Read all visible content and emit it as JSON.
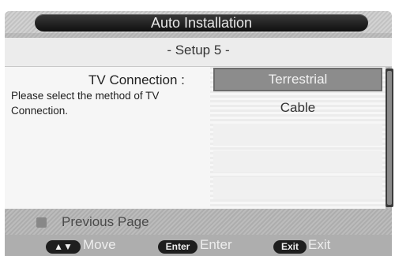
{
  "header": {
    "title": "Auto Installation"
  },
  "setup": {
    "subtitle": "- Setup 5 -"
  },
  "connection": {
    "label": "TV Connection :",
    "description": "Please select the method of TV Connection.",
    "options": [
      {
        "label": "Terrestrial",
        "selected": true
      },
      {
        "label": "Cable",
        "selected": false
      }
    ]
  },
  "footer": {
    "previous_page": "Previous Page",
    "keys": [
      {
        "key": "▲▼",
        "label": "Move"
      },
      {
        "key": "Enter",
        "label": "Enter"
      },
      {
        "key": "Exit",
        "label": "Exit"
      }
    ]
  },
  "colors": {
    "selected_bg": "#8c8c8c",
    "title_bar": "#1a1a1a",
    "help_bar": "#aeaeae"
  }
}
